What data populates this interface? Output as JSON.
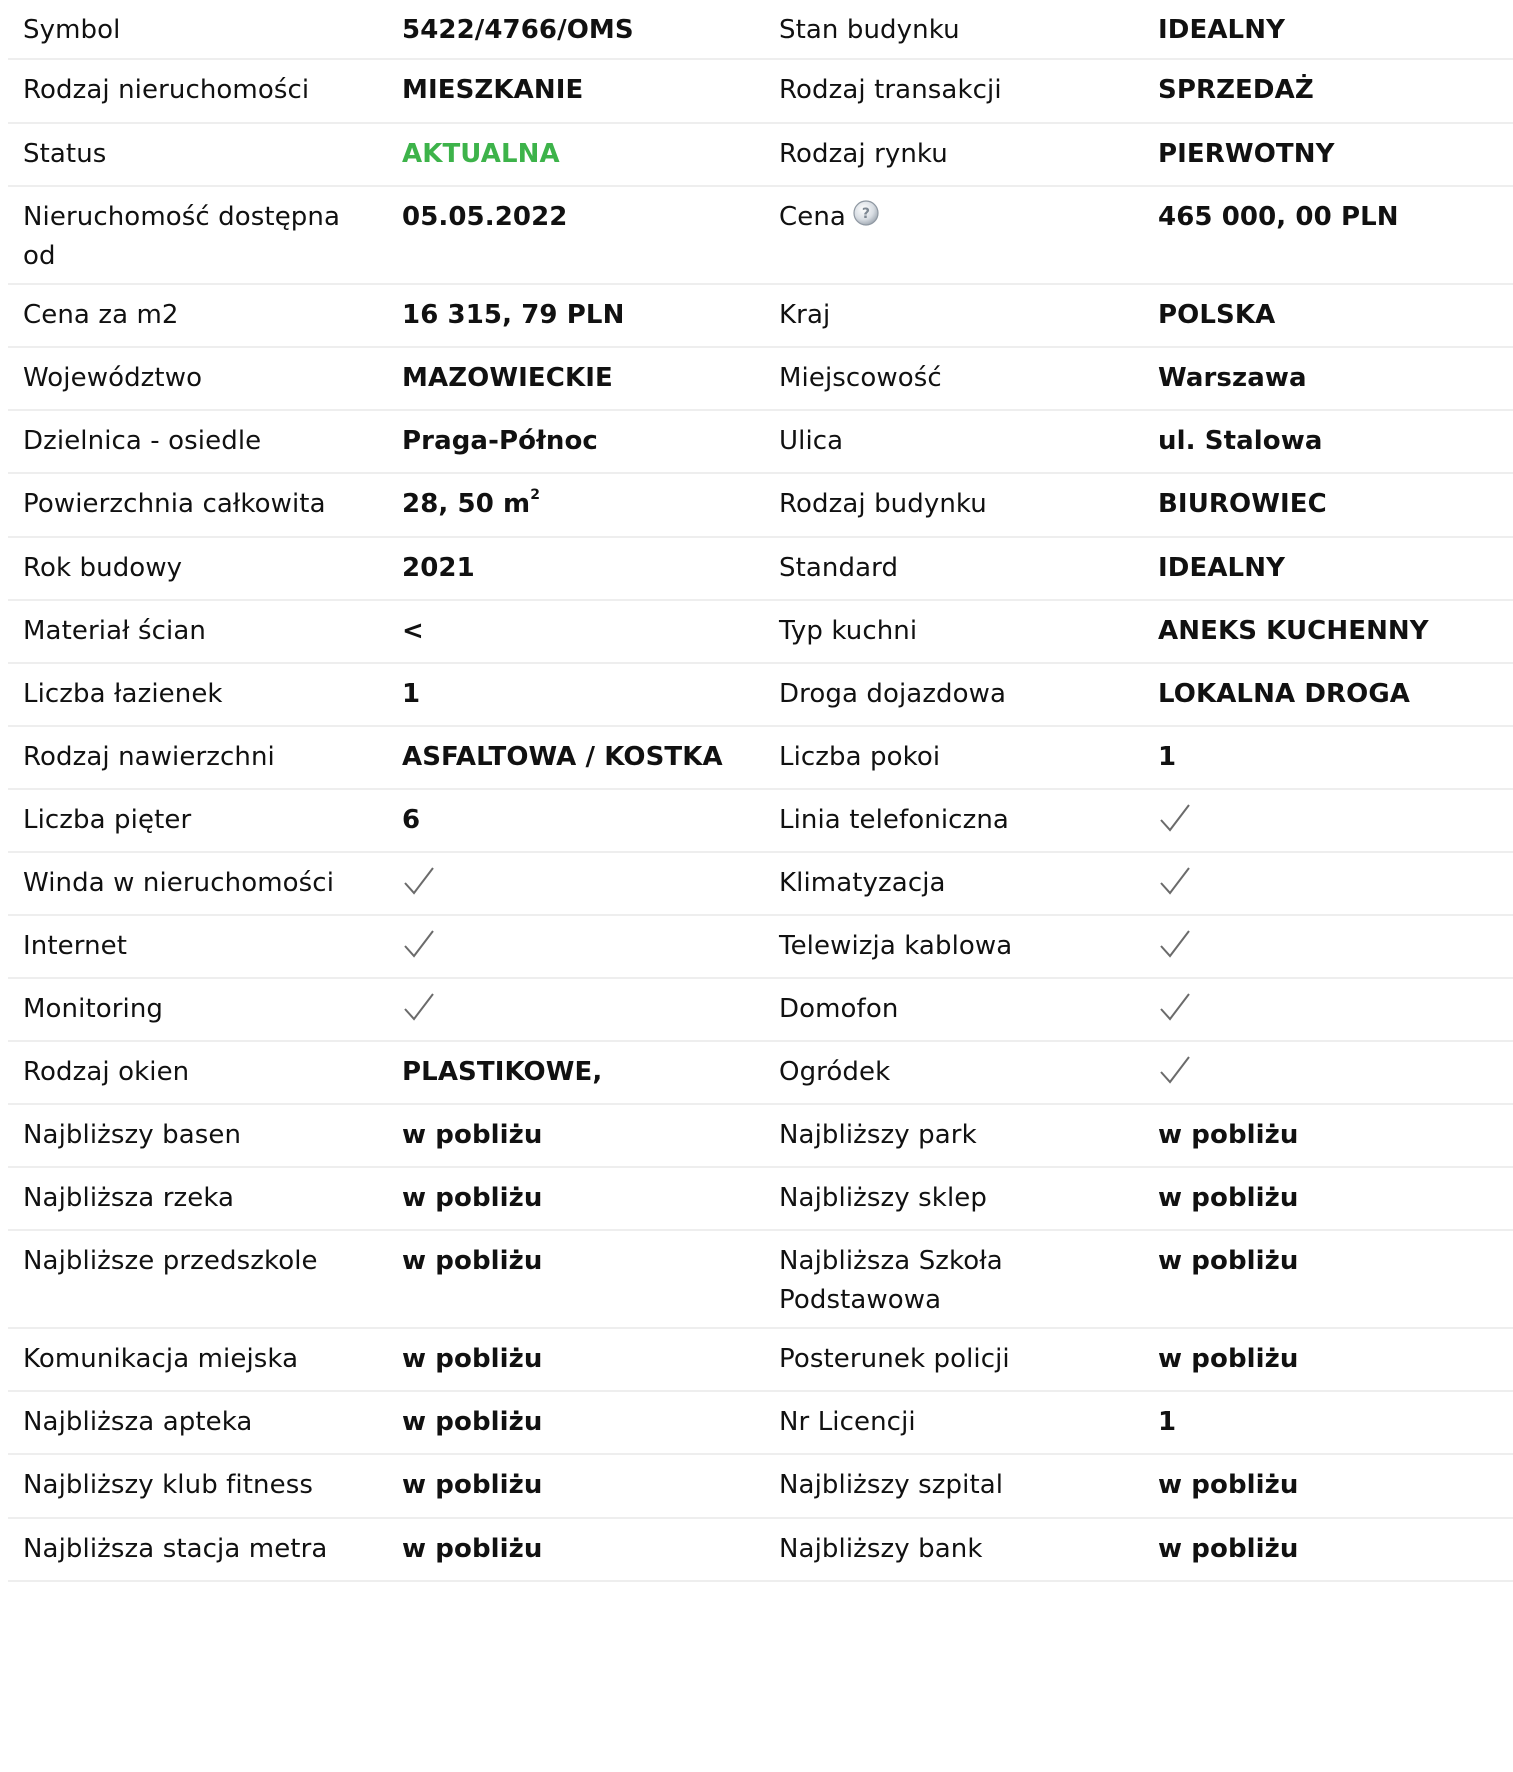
{
  "rows": [
    {
      "label1": "Symbol",
      "value1": "5422/4766/OMS",
      "label2": "Stan budynku",
      "value2": "IDEALNY"
    },
    {
      "label1": "Rodzaj nieruchomości",
      "value1": "MIESZKANIE",
      "label2": "Rodzaj transakcji",
      "value2": "SPRZEDAŻ"
    },
    {
      "label1": "Status",
      "value1": "AKTUALNA",
      "label2": "Rodzaj rynku",
      "value2": "PIERWOTNY"
    },
    {
      "label1": "Nieruchomość dostępna od",
      "value1": "05.05.2022",
      "label2": "Cena",
      "value2": "465 000, 00 PLN"
    },
    {
      "label1": "Cena za m2",
      "value1": "16 315, 79 PLN",
      "label2": "Kraj",
      "value2": "POLSKA"
    },
    {
      "label1": "Województwo",
      "value1": "MAZOWIECKIE",
      "label2": "Miejscowość",
      "value2": "Warszawa"
    },
    {
      "label1": "Dzielnica - osiedle",
      "value1": "Praga-Północ",
      "label2": "Ulica",
      "value2": "ul. Stalowa"
    },
    {
      "label1": "Powierzchnia całkowita",
      "value1": "28, 50 m",
      "value1_sup": "2",
      "label2": "Rodzaj budynku",
      "value2": "BIUROWIEC"
    },
    {
      "label1": "Rok budowy",
      "value1": "2021",
      "label2": "Standard",
      "value2": "IDEALNY"
    },
    {
      "label1": "Materiał ścian",
      "value1": "<",
      "label2": "Typ kuchni",
      "value2": "ANEKS KUCHENNY"
    },
    {
      "label1": "Liczba łazienek",
      "value1": "1",
      "label2": "Droga dojazdowa",
      "value2": "LOKALNA DROGA"
    },
    {
      "label1": "Rodzaj nawierzchni",
      "value1": "ASFALTOWA / KOSTKA",
      "label2": "Liczba pokoi",
      "value2": "1"
    },
    {
      "label1": "Liczba pięter",
      "value1": "6",
      "label2": "Linia telefoniczna",
      "value2": ""
    },
    {
      "label1": "Winda w nieruchomości",
      "value1": "",
      "label2": "Klimatyzacja",
      "value2": ""
    },
    {
      "label1": "Internet",
      "value1": "",
      "label2": "Telewizja kablowa",
      "value2": ""
    },
    {
      "label1": "Monitoring",
      "value1": "",
      "label2": "Domofon",
      "value2": ""
    },
    {
      "label1": "Rodzaj okien",
      "value1": "PLASTIKOWE,",
      "label2": "Ogródek",
      "value2": ""
    },
    {
      "label1": "Najbliższy basen",
      "value1": "w pobliżu",
      "label2": "Najbliższy park",
      "value2": "w pobliżu"
    },
    {
      "label1": "Najbliższa rzeka",
      "value1": "w pobliżu",
      "label2": "Najbliższy sklep",
      "value2": "w pobliżu"
    },
    {
      "label1": "Najbliższe przedszkole",
      "value1": "w pobliżu",
      "label2": "Najbliższa Szkoła Podstawowa",
      "value2": "w pobliżu"
    },
    {
      "label1": "Komunikacja miejska",
      "value1": "w pobliżu",
      "label2": "Posterunek policji",
      "value2": "w pobliżu"
    },
    {
      "label1": "Najbliższa apteka",
      "value1": "w pobliżu",
      "label2": "Nr Licencji",
      "value2": "1"
    },
    {
      "label1": "Najbliższy klub fitness",
      "value1": "w pobliżu",
      "label2": "Najbliższy szpital",
      "value2": "w pobliżu"
    },
    {
      "label1": "Najbliższa stacja metra",
      "value1": "w pobliżu",
      "label2": "Najbliższy bank",
      "value2": "w pobliżu"
    }
  ],
  "colors": {
    "status_green": "#3db34a",
    "divider": "#eeeeee",
    "check": "#6b6b6b"
  },
  "icons": {
    "check": "check-icon",
    "help": "help-icon"
  }
}
